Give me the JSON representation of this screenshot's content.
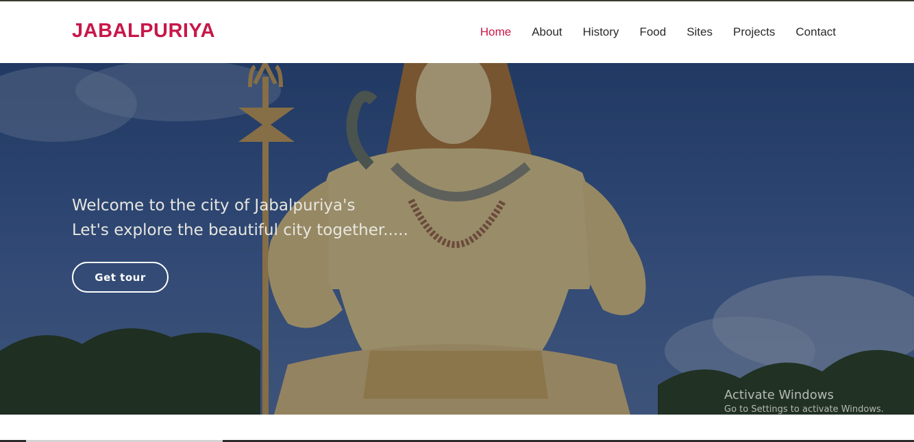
{
  "brand": {
    "logo": "JABALPURIYA",
    "accent": "#c8174a"
  },
  "nav": {
    "items": [
      {
        "label": "Home",
        "active": true
      },
      {
        "label": "About",
        "active": false
      },
      {
        "label": "History",
        "active": false
      },
      {
        "label": "Food",
        "active": false
      },
      {
        "label": "Sites",
        "active": false
      },
      {
        "label": "Projects",
        "active": false
      },
      {
        "label": "Contact",
        "active": false
      }
    ]
  },
  "hero": {
    "line1": "Welcome to the city of Jabalpuriya's",
    "line2": "Let's explore the beautiful city together.....",
    "button_label": "Get tour",
    "image": "shiva-statue-photo"
  },
  "watermark": {
    "title": "Activate Windows",
    "subtitle": "Go to Settings to activate Windows."
  }
}
